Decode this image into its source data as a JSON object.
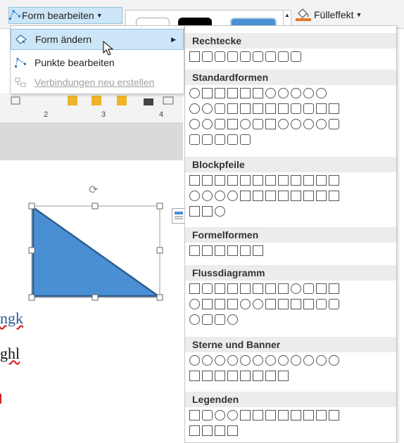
{
  "ribbon": {
    "form_button_label": "Form bearbeiten",
    "fill_button_label": "Fülleffekt"
  },
  "menu": {
    "items": [
      {
        "label": "Form ändern",
        "icon": "change-shape-icon"
      },
      {
        "label": "Punkte bearbeiten",
        "icon": "edit-points-icon"
      },
      {
        "label": "Verbindungen neu erstellen",
        "icon": "reroute-connectors-icon",
        "disabled": true
      }
    ]
  },
  "ruler": {
    "labels": [
      "2",
      "3",
      "4"
    ]
  },
  "panel": {
    "sections": [
      {
        "title": "Rechtecke"
      },
      {
        "title": "Standardformen"
      },
      {
        "title": "Blockpfeile"
      },
      {
        "title": "Formelformen"
      },
      {
        "title": "Flussdiagramm"
      },
      {
        "title": "Sterne und Banner"
      },
      {
        "title": "Legenden"
      }
    ]
  },
  "document": {
    "text1": "ngk",
    "text2": "ghl"
  },
  "colors": {
    "accent": "#cde6f7",
    "triangle_fill": "#4a8fd3",
    "triangle_stroke": "#2f5e8f"
  }
}
